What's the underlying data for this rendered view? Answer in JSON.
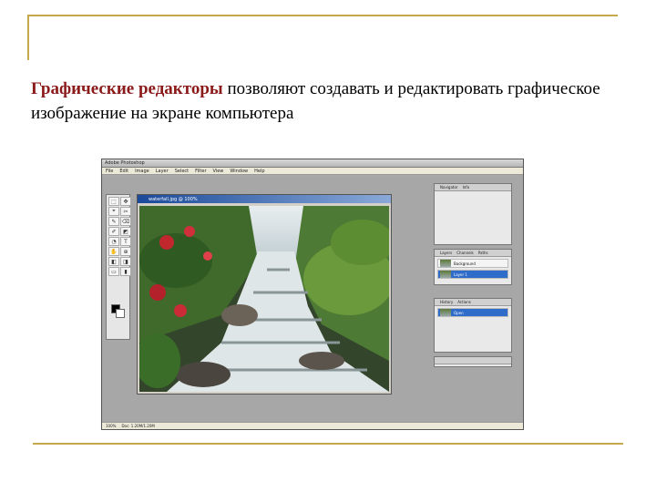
{
  "slide": {
    "caption_accent": "Графические редакторы",
    "caption_rest": " позволяют создавать и редактировать графическое изображение на экране компьютера"
  },
  "app": {
    "window_title": "Adobe Photoshop",
    "menu": [
      "File",
      "Edit",
      "Image",
      "Layer",
      "Select",
      "Filter",
      "View",
      "Window",
      "Help"
    ],
    "document_title": "waterfall.jpg @ 100%",
    "layers_tabs": [
      "Layers",
      "Channels",
      "Paths"
    ],
    "layers": [
      {
        "name": "Background",
        "selected": false
      },
      {
        "name": "Layer 1",
        "selected": true
      }
    ],
    "history_tabs": [
      "History",
      "Actions"
    ],
    "history_items": [
      {
        "name": "Open",
        "selected": true
      }
    ],
    "nav_tabs": [
      "Navigator",
      "Info"
    ],
    "status_zoom": "100%",
    "status_doc": "Doc: 1.20M/1.20M"
  }
}
